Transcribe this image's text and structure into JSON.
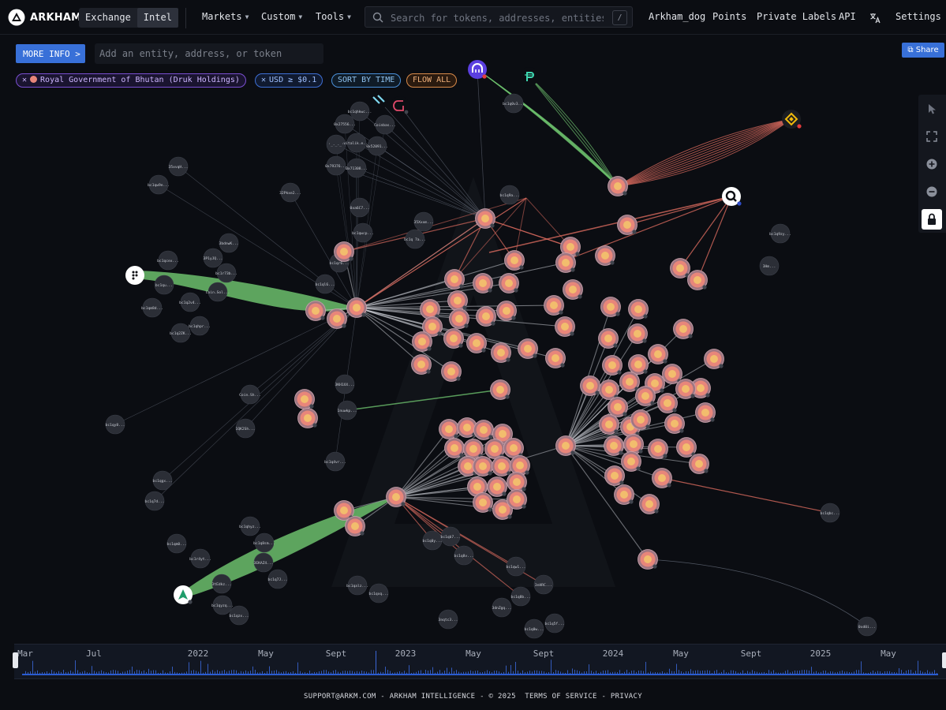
{
  "header": {
    "brand": "ARKHAM",
    "modes": [
      {
        "label": "Exchange",
        "active": false
      },
      {
        "label": "Intel",
        "active": true
      }
    ],
    "nav": [
      {
        "label": "Markets"
      },
      {
        "label": "Custom"
      },
      {
        "label": "Tools"
      }
    ],
    "search": {
      "placeholder": "Search for tokens, addresses, entities...",
      "shortcut": "/"
    },
    "links": [
      "Arkham_dog",
      "Points",
      "Private Labels",
      "API",
      "Settings"
    ]
  },
  "controls": {
    "more_info": "MORE INFO >",
    "entity_placeholder": "Add an entity, address, or token",
    "share": "Share",
    "chips": {
      "entity": "Royal Government of Bhutan (Druk Holdings)",
      "usd": "USD ≥ $0.1",
      "sort": "SORT BY TIME",
      "flow": "FLOW ALL"
    }
  },
  "graph": {
    "address_labels": [
      "bc1qhkwc...",
      "0x27556...",
      "Coinbas...",
      "'_-_-_'",
      "vitalik.e...",
      "0x52091...",
      "0x79376...",
      "0x71308...",
      "35xvqH...",
      "bc1qw9e...",
      "32Pkxe2...",
      "bc1q0v3...",
      "bc1q9a...",
      "35Xxxm...",
      "bc1q 7a...",
      "3bdnwK...",
      "bc1qcex...",
      "3P1yJQ...",
      "bc1r73b...",
      "bc1qu...",
      "Coin.Sol...",
      "bc1qm8d...",
      "bc1q2v4...",
      "bc1qhpr...",
      "bc1q2ZK...",
      "3KH1XX...",
      "Coin.Sh...",
      "1nuwkp...",
      "1QK2Sh...",
      "bc1qy8...",
      "bc1q4vr...",
      "bc1qgx...",
      "bc1q7d...",
      "bc1qhyz...",
      "bc1qm0...",
      "bc1q8sm...",
      "bc1r4yt...",
      "3EKAZ4...",
      "bc1q7J...",
      "3tEdkz...",
      "bc1qyzq...",
      "bc1qzx...",
      "bc1qalz...",
      "bc1qxq...",
      "bc1q0y...",
      "bc1qb7...",
      "bc1q8v...",
      "bc1qw1...",
      "3nHRC...",
      "bc1q8b...",
      "3dnZgq...",
      "bc1q0w...",
      "bc1q5f...",
      "3nqtc3...",
      "bc1qbc...",
      "0xd0i...",
      "bc1q9zy...",
      "3Hm...",
      "0xa6C7...",
      "bc1qwcp...",
      "bc1qr6...",
      "bc1ql6..."
    ]
  },
  "timeline": {
    "labels": [
      "Mar",
      "Jul",
      "2022",
      "May",
      "Sept",
      "2023",
      "May",
      "Sept",
      "2024",
      "May",
      "Sept",
      "2025",
      "May"
    ]
  },
  "footer": {
    "text": "SUPPORT@ARKM.COM - ARKHAM INTELLIGENCE - © 2025",
    "terms": "TERMS OF SERVICE",
    "sep": " - ",
    "privacy": "PRIVACY"
  },
  "colors": {
    "background": "#0b0d12",
    "accent": "#3870d8",
    "inflow_edge": "#6cbf6c",
    "outflow_edge": "#d96a5e",
    "neutral_edge": "#c8cbd2",
    "bhutan_node": "#e8867a"
  }
}
